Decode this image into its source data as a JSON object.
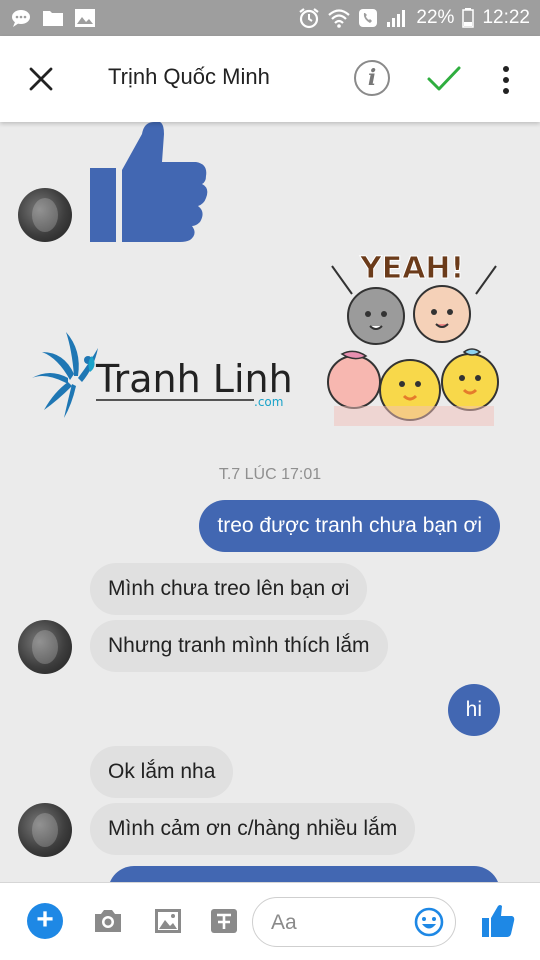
{
  "status_bar": {
    "battery": "22%",
    "time": "12:22",
    "icons": [
      "chat-icon",
      "folder-icon",
      "image-icon",
      "alarm-icon",
      "wifi-icon",
      "call-icon",
      "signal-icon",
      "battery-icon"
    ]
  },
  "header": {
    "title": "Trịnh Quốc Minh",
    "icons": [
      "close-icon",
      "info-icon",
      "check-icon",
      "more-vertical-icon"
    ],
    "info_glyph": "i"
  },
  "stickers": {
    "logo_text": "Tranh Linh",
    "logo_domain": ".com",
    "yeah_text": "YEAH!"
  },
  "chat": {
    "timestamp": "T.7 LÚC 17:01",
    "messages": [
      {
        "side": "out",
        "text": "treo được tranh chưa bạn ơi"
      },
      {
        "side": "in",
        "text": "Mình chưa treo lên bạn ơi"
      },
      {
        "side": "in",
        "text": "Nhưng tranh mình thích lắm"
      },
      {
        "side": "out",
        "text": "hi"
      },
      {
        "side": "in",
        "text": "Ok lắm nha"
      },
      {
        "side": "in",
        "text": "Mình cảm ơn c/hàng nhiều lắm"
      }
    ]
  },
  "composer": {
    "plus": "+",
    "placeholder": "Aa",
    "icons": [
      "plus-icon",
      "camera-icon",
      "gallery-icon",
      "sticker-icon",
      "emoji-icon",
      "thumbs-up-icon"
    ]
  },
  "colors": {
    "brand_blue": "#4267b2",
    "check_green": "#2fae3f",
    "plus_blue": "#1e88e5",
    "status_gray": "#9e9e9e",
    "chat_bg": "#ebebeb"
  }
}
